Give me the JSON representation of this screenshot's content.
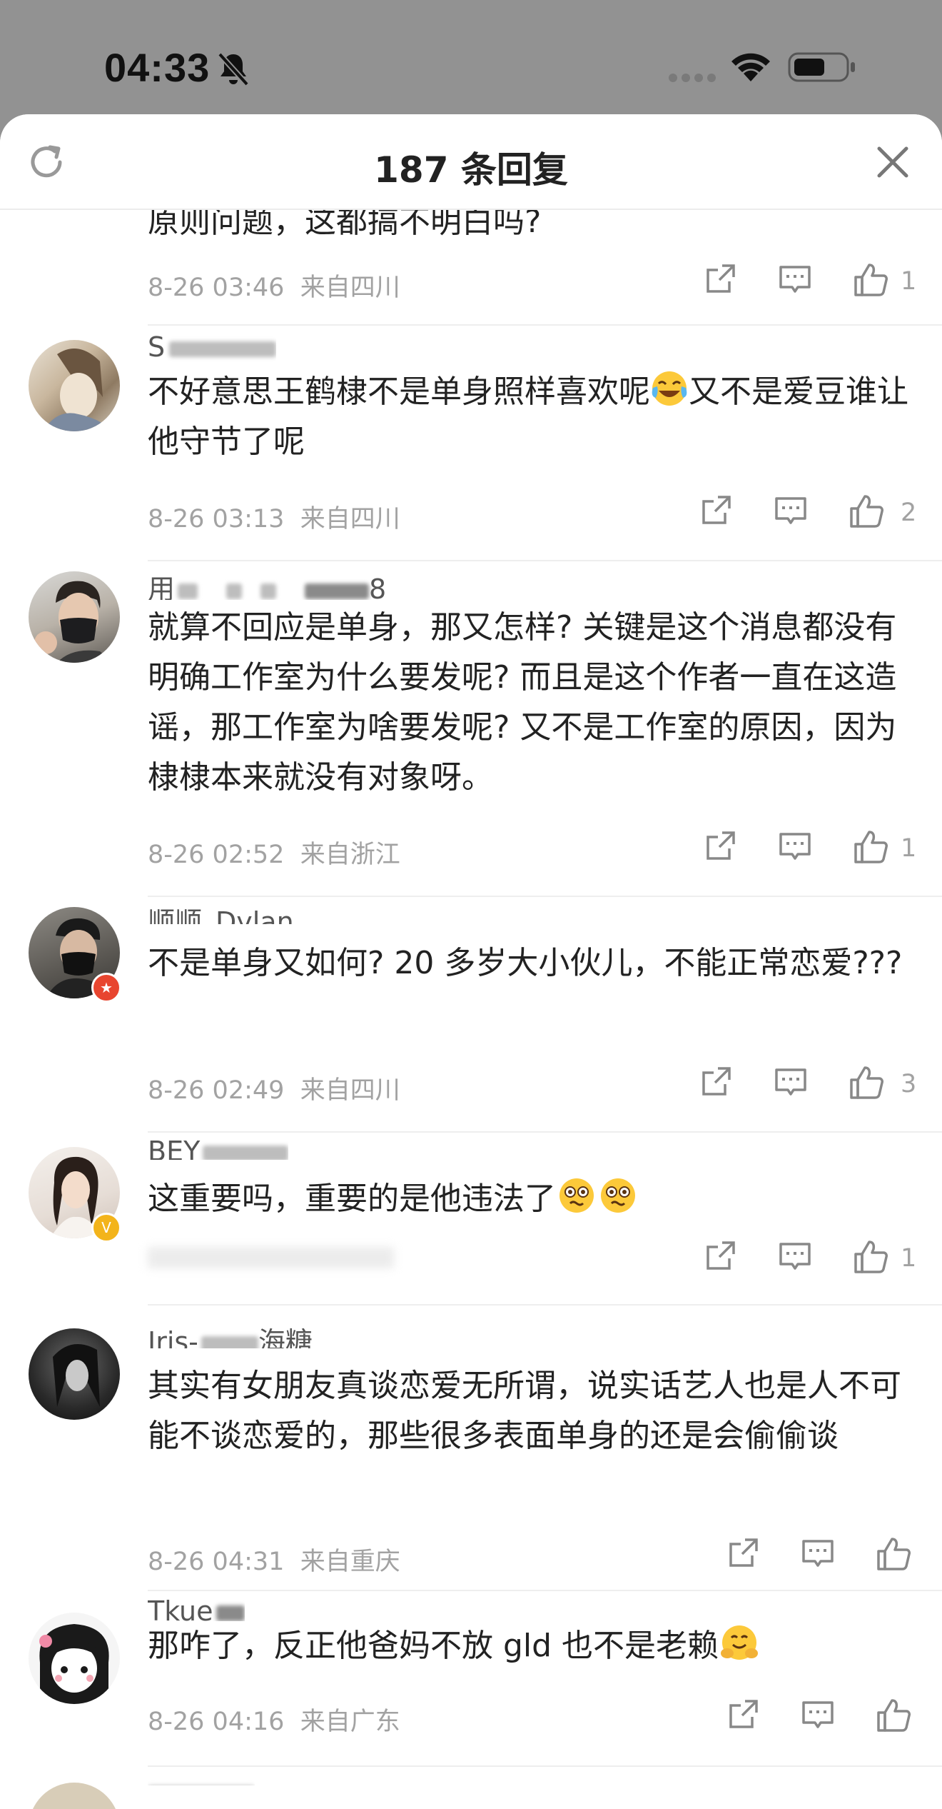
{
  "status_bar": {
    "time": "04:33"
  },
  "header": {
    "title": "187 条回复"
  },
  "comments": [
    {
      "username": "",
      "text": "原则问题，这都搞不明白吗?",
      "date": "8-26 03:46",
      "location": "来自四川",
      "likes": "1"
    },
    {
      "username": "S",
      "text": "不好意思王鹤棣不是单身照样喜欢呢",
      "text_after_emoji": "又不是爱豆谁让他守节了呢",
      "date": "8-26 03:13",
      "location": "来自四川",
      "likes": "2"
    },
    {
      "username": "用",
      "username_suffix": "8",
      "text": "就算不回应是单身，那又怎样? 关键是这个消息都没有明确工作室为什么要发呢? 而且是这个作者一直在这造谣，那工作室为啥要发呢? 又不是工作室的原因，因为棣棣本来就没有对象呀。",
      "date": "8-26 02:52",
      "location": "来自浙江",
      "likes": "1"
    },
    {
      "username": "顺顺_Dylan",
      "text": "不是单身又如何? 20 多岁大小伙儿，不能正常恋爱???",
      "date": "8-26 02:49",
      "location": "来自四川",
      "likes": "3"
    },
    {
      "username": "BEY",
      "text": "这重要吗，重要的是他违法了",
      "date": "",
      "location": "",
      "likes": "1"
    },
    {
      "username": "Iris-",
      "username_suffix": "海糖",
      "text": "其实有女朋友真谈恋爱无所谓，说实话艺人也是人不可能不谈恋爱的，那些很多表面单身的还是会偷偷谈",
      "date": "8-26 04:31",
      "location": "来自重庆",
      "likes": ""
    },
    {
      "username": "Tkue",
      "text": "那咋了，反正他爸妈不放 gld 也不是老赖",
      "date": "8-26 04:16",
      "location": "来自广东",
      "likes": ""
    }
  ],
  "colors": {
    "backdrop": "#929292",
    "sheet": "#ffffff",
    "text": "#222222",
    "meta": "#a2a2a2",
    "divider": "#eeeeee"
  },
  "icons": [
    "muted-bell-icon",
    "wifi-icon",
    "battery-icon",
    "refresh-icon",
    "close-icon",
    "share-icon",
    "comment-icon",
    "like-icon",
    "laughing-crying-emoji",
    "flushed-emoji",
    "hugging-emoji"
  ]
}
